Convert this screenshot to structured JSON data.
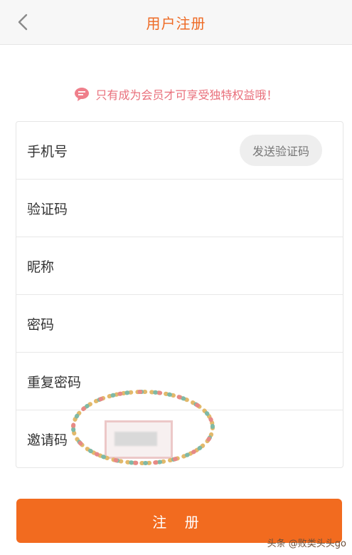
{
  "header": {
    "title": "用户注册",
    "back_icon": "chevron-left-icon"
  },
  "notice": {
    "text": "只有成为会员才可享受独特权益哦！",
    "icon": "chat-bubble-icon",
    "color": "#e96f7b"
  },
  "form": {
    "rows": [
      {
        "label": "手机号",
        "button": "发送验证码"
      },
      {
        "label": "验证码"
      },
      {
        "label": "昵称"
      },
      {
        "label": "密码"
      },
      {
        "label": "重复密码"
      },
      {
        "label": "邀请码"
      }
    ]
  },
  "submit": {
    "label": "注 册",
    "color": "#f26b1f"
  },
  "watermark": "头条 @败类头头go",
  "colors": {
    "accent": "#ee6a24"
  }
}
